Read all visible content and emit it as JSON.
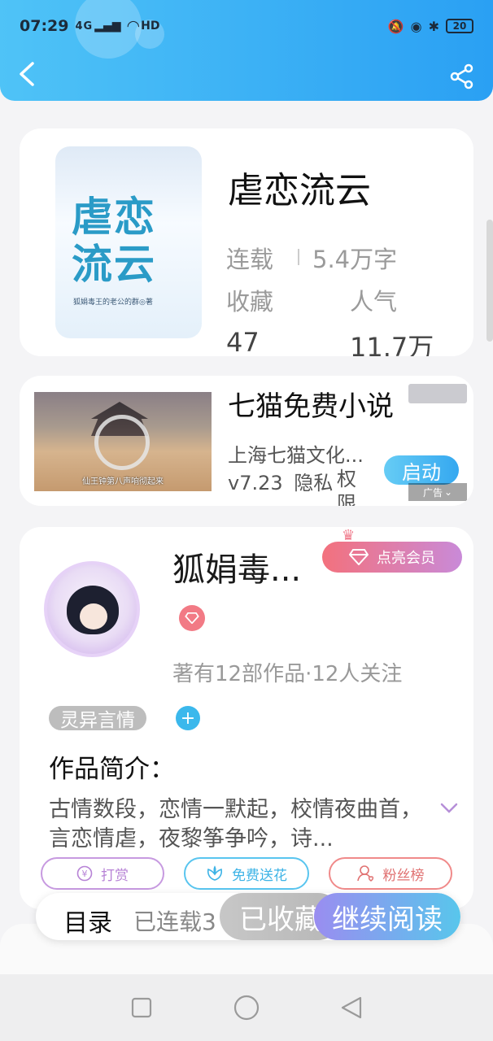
{
  "status_bar": {
    "time": "07:29",
    "network": "4G",
    "hd": "HD",
    "battery": "20"
  },
  "book": {
    "title": "虐恋流云",
    "cover_title": "虐恋流云",
    "cover_author": "狐娟毒王的老公的群◎著",
    "status": "连载",
    "word_count": "5.4万字",
    "favorites_label": "收藏",
    "favorites_value": "47",
    "popularity_label": "人气",
    "popularity_value": "11.7万"
  },
  "ad": {
    "title": "七猫免费小说",
    "company": "上海七猫文化...",
    "version": "v7.23",
    "privacy": "隐私",
    "permission": "权限",
    "launch_label": "启动",
    "ad_label": "广告",
    "video_subtitle": "仙王钟第八声响彻起来"
  },
  "author": {
    "name": "狐娟毒...",
    "vip_label": "点亮会员",
    "stats": "著有12部作品·12人关注",
    "genre_tag": "灵异言情",
    "add_tag": "+",
    "intro_title": "作品简介：",
    "intro_text": "古情数段，恋情一默起，校情夜曲首，言恋情虐，夜黎筝争吟，诗...",
    "actions": [
      {
        "label": "打赏",
        "color": "#c79ae0",
        "icon": "yen-icon"
      },
      {
        "label": "免费送花",
        "color": "#59c5ef",
        "icon": "flower-icon"
      },
      {
        "label": "粉丝榜",
        "color": "#f08a8a",
        "icon": "fans-icon"
      }
    ]
  },
  "bottom_bar": {
    "toc_label": "目录",
    "toc_status": "已连载3",
    "collected_label": "已收藏",
    "read_label": "继续阅读"
  },
  "colors": {
    "header": "#2aa0f3",
    "vip": "#f3717d",
    "accent": "#3bb8ec"
  }
}
